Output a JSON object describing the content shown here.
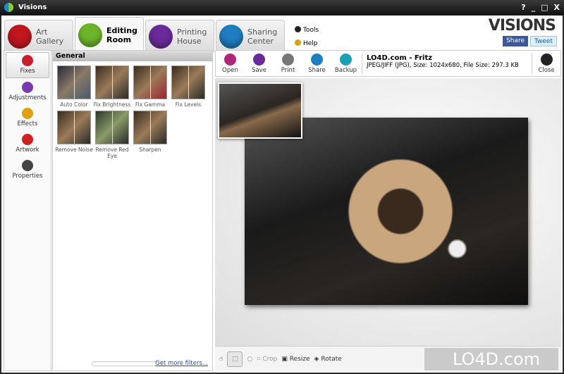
{
  "window": {
    "title": "Visions",
    "controls": [
      "?",
      "_",
      "□",
      "X"
    ]
  },
  "tabs": [
    {
      "label1": "Art",
      "label2": "Gallery",
      "color": "#c0161e"
    },
    {
      "label1": "Editing",
      "label2": "Room",
      "color": "#6cb52a"
    },
    {
      "label1": "Printing",
      "label2": "House",
      "color": "#6a2a9a"
    },
    {
      "label1": "Sharing",
      "label2": "Center",
      "color": "#1f7dc0"
    }
  ],
  "links": {
    "tools": "Tools",
    "help": "Help"
  },
  "brand": "VISIONS",
  "social": {
    "share": "Share",
    "tweet": "Tweet"
  },
  "sidebar": [
    {
      "label": "Fixes",
      "color": "#c8202a"
    },
    {
      "label": "Adjustments",
      "color": "#7a3ab0"
    },
    {
      "label": "Effects",
      "color": "#e0a010"
    },
    {
      "label": "Artwork",
      "color": "#d02020"
    },
    {
      "label": "Properties",
      "color": "#444"
    }
  ],
  "filters": {
    "header": "General",
    "items": [
      "Auto Color",
      "Fix Brightness",
      "Fix Gamma",
      "Fix Levels",
      "Remove Noise",
      "Remove Red Eye",
      "Sharpen"
    ],
    "more_link": "Get more filters..."
  },
  "toolbar": [
    {
      "label": "Open",
      "color": "#b0267a"
    },
    {
      "label": "Save",
      "color": "#6a2a9a"
    },
    {
      "label": "Print",
      "color": "#777"
    },
    {
      "label": "Share",
      "color": "#1f7dc0"
    },
    {
      "label": "Backup",
      "color": "#1aa0b8"
    }
  ],
  "file": {
    "title": "LO4D.com - Fritz",
    "details": "JPEG/JIFF (JPG), Size: 1024x680, File Size: 297.3 KB"
  },
  "close_label": "Close",
  "bottom": {
    "crop": "Crop",
    "resize": "Resize",
    "rotate": "Rotate"
  },
  "watermark": "LO4D.com"
}
